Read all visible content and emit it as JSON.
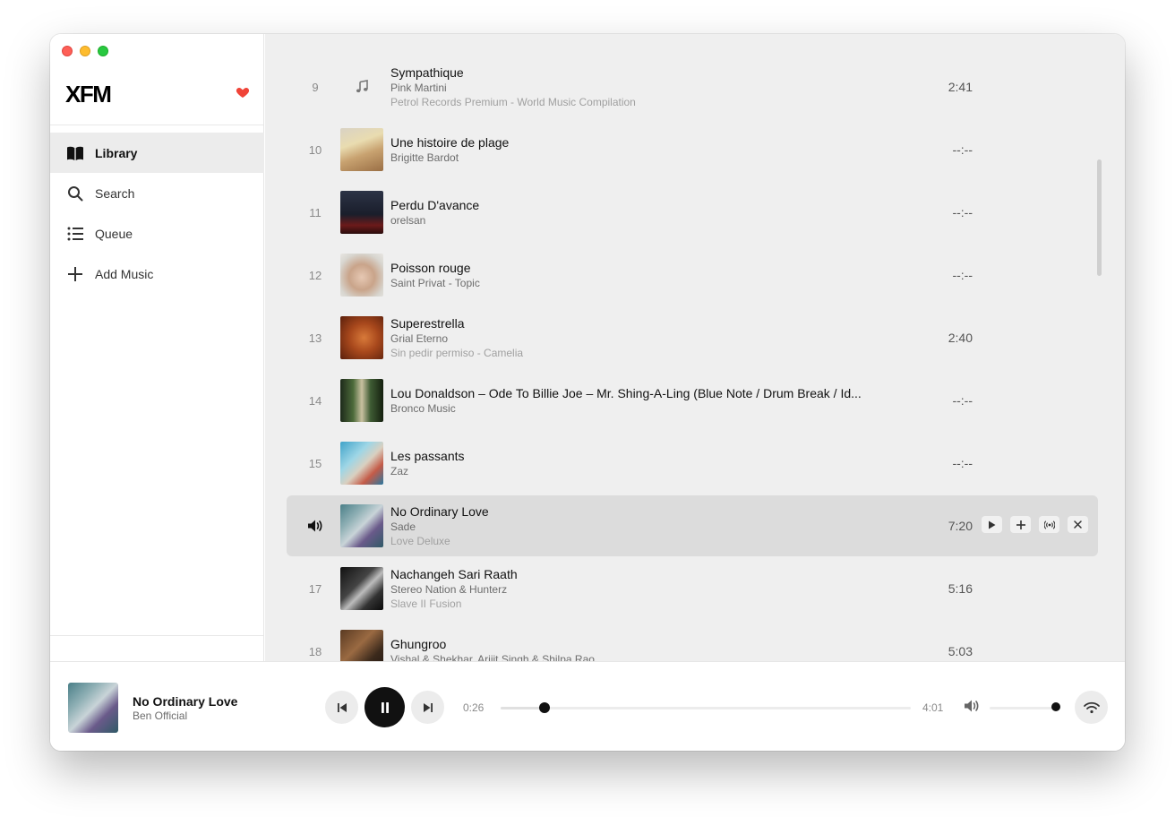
{
  "app": {
    "brand": "XFM"
  },
  "sidebar": {
    "items": [
      {
        "label": "Library",
        "icon": "book-icon",
        "active": true
      },
      {
        "label": "Search",
        "icon": "search-icon",
        "active": false
      },
      {
        "label": "Queue",
        "icon": "list-icon",
        "active": false
      },
      {
        "label": "Add Music",
        "icon": "plus-icon",
        "active": false
      }
    ]
  },
  "tracks": [
    {
      "num": "9",
      "title": "Sympathique",
      "artist": "Pink Martini",
      "album": "Petrol Records Premium - World Music Compilation",
      "duration": "2:41"
    },
    {
      "num": "10",
      "title": "Une histoire de plage",
      "artist": "Brigitte Bardot",
      "album": "",
      "duration": "--:--"
    },
    {
      "num": "11",
      "title": "Perdu D'avance",
      "artist": "orelsan",
      "album": "",
      "duration": "--:--"
    },
    {
      "num": "12",
      "title": "Poisson rouge",
      "artist": "Saint Privat - Topic",
      "album": "",
      "duration": "--:--"
    },
    {
      "num": "13",
      "title": "Superestrella",
      "artist": "Grial Eterno",
      "album": "Sin pedir permiso - Camelia",
      "duration": "2:40"
    },
    {
      "num": "14",
      "title": "Lou Donaldson – Ode To Billie Joe – Mr. Shing-A-Ling (Blue Note / Drum Break / Id...",
      "artist": "Bronco Music",
      "album": "",
      "duration": "--:--"
    },
    {
      "num": "15",
      "title": "Les passants",
      "artist": "Zaz",
      "album": "",
      "duration": "--:--"
    },
    {
      "num": "",
      "title": "No Ordinary Love",
      "artist": "Sade",
      "album": "Love Deluxe",
      "duration": "7:20",
      "playing": true
    },
    {
      "num": "17",
      "title": "Nachangeh Sari Raath",
      "artist": "Stereo Nation & Hunterz",
      "album": "Slave II Fusion",
      "duration": "5:16"
    },
    {
      "num": "18",
      "title": "Ghungroo",
      "artist": "Vishal & Shekhar, Arijit Singh & Shilpa Rao",
      "album": "",
      "duration": "5:03"
    }
  ],
  "player": {
    "title": "No Ordinary Love",
    "artist": "Ben Official",
    "elapsed": "0:26",
    "total": "4:01",
    "progress_fraction": 0.108,
    "volume_fraction": 1.0
  },
  "colors": {
    "heart": "#f04438",
    "playing_row": "#dcdcdc",
    "list_bg": "#efefef"
  }
}
